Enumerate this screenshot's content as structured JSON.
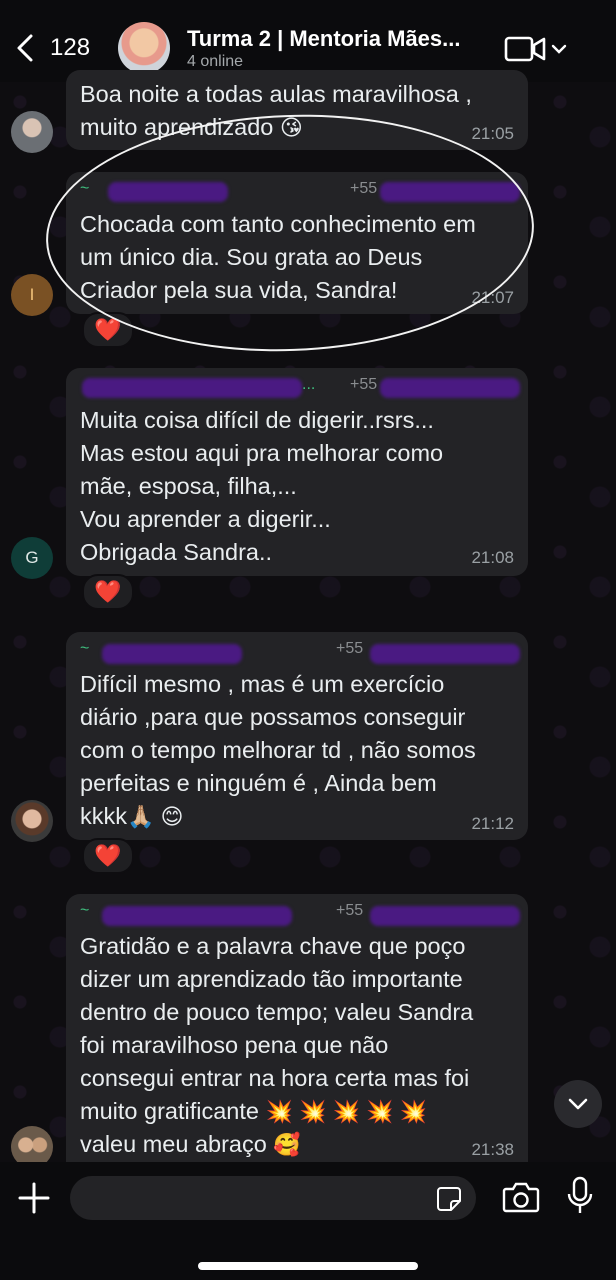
{
  "header": {
    "back_count": "128",
    "title": "Turma 2 | Mentoria Mães...",
    "subtitle": "4 online"
  },
  "messages": [
    {
      "text": "Boa noite a todas aulas maravilhosa ,\nmuito aprendizado",
      "emoji": "😘",
      "time": "21:05"
    },
    {
      "sender_prefix": "~",
      "phone_prefix": "+55",
      "text": "Chocada com tanto conhecimento em\num único dia. Sou grata ao Deus\nCriador pela sua vida, Sandra!",
      "time": "21:07",
      "avatar_initial": "I",
      "reaction": "❤️"
    },
    {
      "sender_suffix": "...",
      "phone_prefix": "+55",
      "text": "Muita coisa difícil de digerir..rsrs...\nMas estou aqui pra melhorar como\nmãe, esposa, filha,...\nVou aprender a digerir...\nObrigada Sandra..",
      "time": "21:08",
      "avatar_initial": "G",
      "reaction": "❤️"
    },
    {
      "sender_prefix": "~",
      "phone_prefix": "+55",
      "text": "Difícil mesmo , mas é um exercício\ndiário ,para que possamos conseguir\ncom o tempo melhorar td , não somos\nperfeitas e ninguém é , Ainda bem\nkkkk",
      "emoji": "🙏🏼 😊",
      "time": "21:12",
      "reaction": "❤️"
    },
    {
      "sender_prefix": "~",
      "phone_prefix": "+55",
      "text": "Gratidão e a palavra chave que poço\ndizer um aprendizado  tão importante\ndentro de pouco tempo; valeu Sandra\nfoi maravilhoso pena que não\nconsegui entrar na hora certa mas foi\nmuito gratificante",
      "emoji_line": "💥 💥 💥 💥 💥",
      "last_line": "valeu meu abraço",
      "last_emoji": "🥰",
      "time": "21:38"
    }
  ],
  "composer": {
    "placeholder": ""
  },
  "colors": {
    "sender_name": "#3fbf7f",
    "bubble": "#232326",
    "reaction_heart": "#e53935",
    "redaction": "#4a1a82"
  }
}
